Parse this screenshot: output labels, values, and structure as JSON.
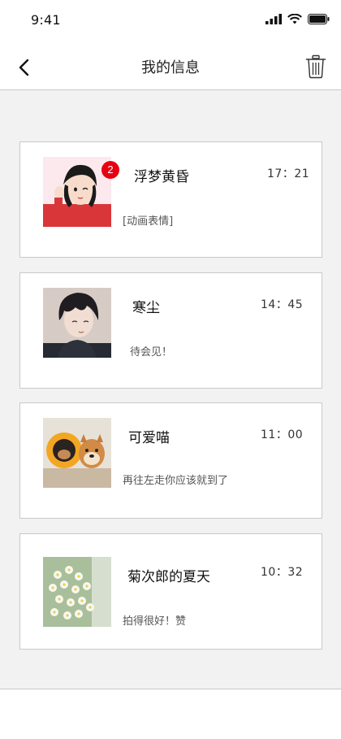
{
  "status_bar": {
    "time": "9:41"
  },
  "nav": {
    "title": "我的信息"
  },
  "messages": [
    {
      "name": "浮梦黄昏",
      "time": "17：21",
      "preview": "[动画表情]",
      "unread": "2"
    },
    {
      "name": "寒尘",
      "time": "14：45",
      "preview": "待会见！"
    },
    {
      "name": "可爱喵",
      "time": "11：00",
      "preview": "再往左走你应该就到了"
    },
    {
      "name": "菊次郎的夏天",
      "time": "10：32",
      "preview": "拍得很好！赞"
    }
  ],
  "colors": {
    "badge": "#e60012",
    "content_bg": "#f2f2f2",
    "card_border": "#c9c9c9"
  }
}
